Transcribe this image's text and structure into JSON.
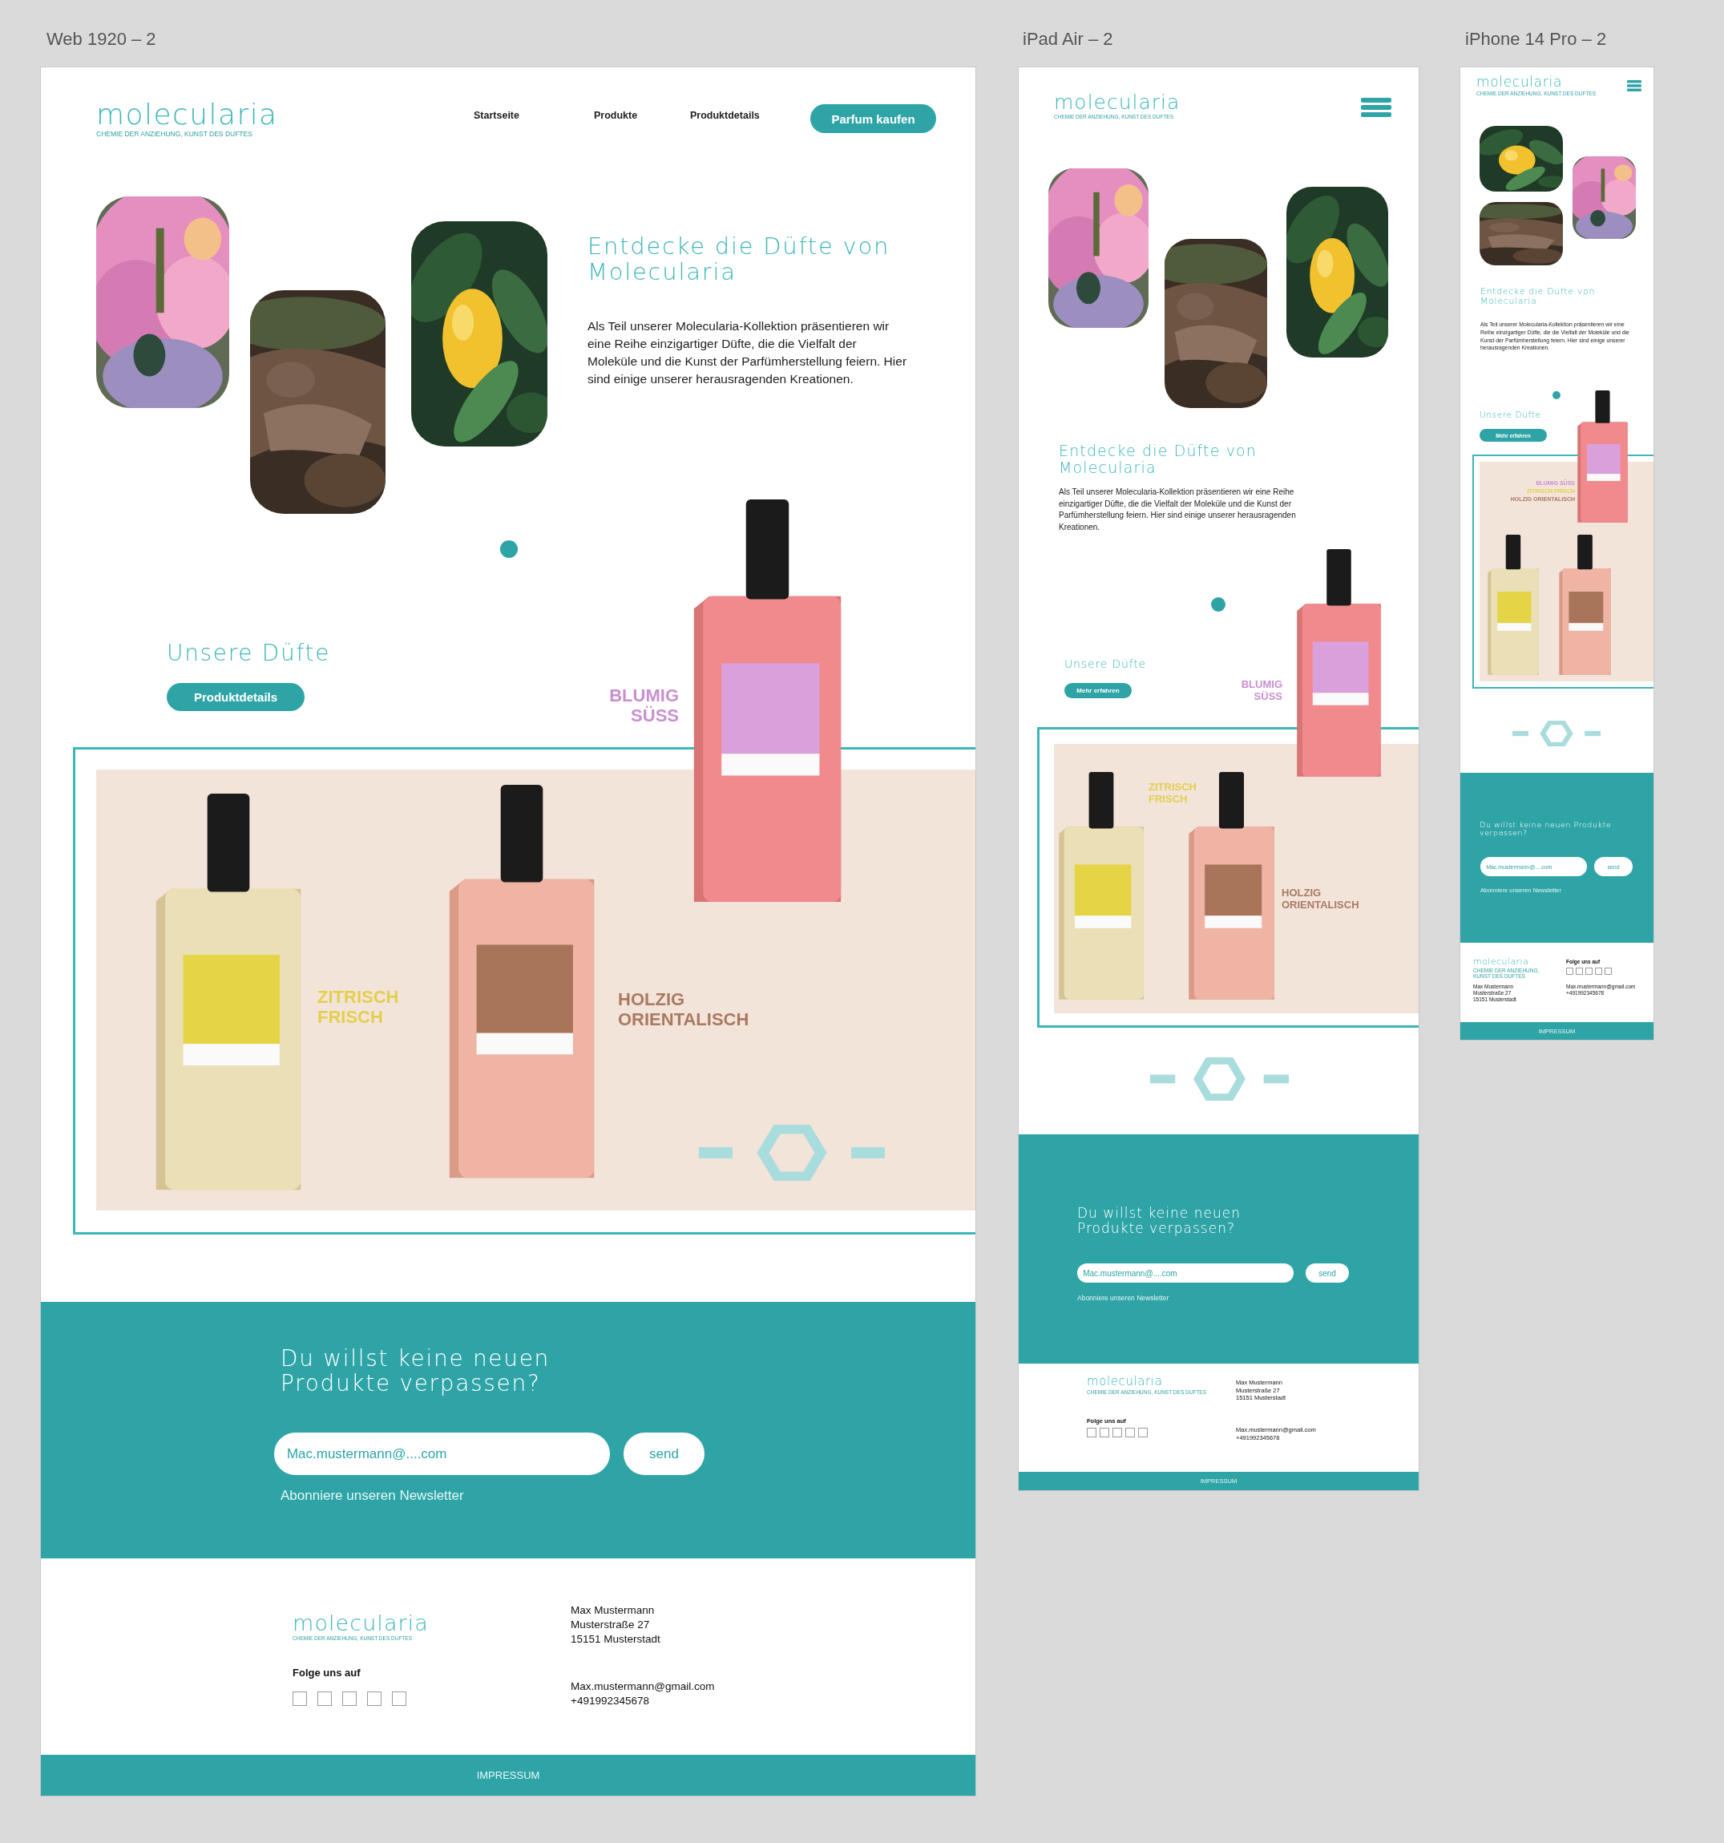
{
  "artboards": [
    {
      "kind": "web",
      "title": "Web 1920 – 2",
      "logo": {
        "name": "molecularia",
        "tagline": "CHEMIE DER ANZIEHUNG, KUNST DES DUFTES"
      },
      "nav": [
        "Startseite",
        "Produkte",
        "Produktdetails"
      ],
      "cta": "Parfum kaufen",
      "hero": {
        "heading": "Entdecke die Düfte von Molecularia",
        "text": "Als Teil unserer Molecularia-Kollektion präsentieren wir eine Reihe einzigartiger Düfte, die die Vielfalt der Moleküle und die Kunst der Parfümherstellung feiern. Hier sind einige unserer herausragenden Kreationen."
      },
      "section": {
        "heading": "Unsere Düfte",
        "button": "Produktdetails"
      },
      "scents": [
        {
          "label": "BLUMIG SÜSS",
          "color": "#c98fd0"
        },
        {
          "label": "ZITRISCH FRISCH",
          "color": "#e3cf4f"
        },
        {
          "label": "HOLZIG ORIENTALISCH",
          "color": "#a97a62"
        }
      ],
      "newsletter": {
        "heading": "Du willst keine neuen Produkte verpassen?",
        "placeholder": "Mac.mustermann@....com",
        "button": "send",
        "note": "Abonniere unseren Newsletter"
      },
      "footer": {
        "logo": {
          "name": "molecularia",
          "tagline": "CHEMIE DER ANZIEHUNG, KUNST DES DUFTES"
        },
        "follow": "Folge uns auf",
        "address": [
          "Max Mustermann",
          "Musterstraße 27",
          "15151 Musterstadt"
        ],
        "contact": [
          "Max.mustermann@gmail.com",
          "+491992345678"
        ]
      },
      "impressum": "IMPRESSUM"
    },
    {
      "kind": "tablet",
      "title": "iPad Air – 2",
      "logo": {
        "name": "molecularia",
        "tagline": "CHEMIE DER ANZIEHUNG, KUNST DES DUFTES"
      },
      "hero": {
        "heading": "Entdecke die Düfte von Molecularia",
        "text": "Als Teil unserer Molecularia-Kollektion präsentieren wir eine Reihe einzigartiger Düfte, die die Vielfalt der Moleküle und die Kunst der Parfümherstellung feiern. Hier sind einige unserer herausragenden Kreationen."
      },
      "section": {
        "heading": "Unsere Düfte",
        "button": "Mehr erfahren"
      },
      "scents": [
        {
          "label": "BLUMIG SÜSS",
          "color": "#c98fd0"
        },
        {
          "label": "ZITRISCH FRISCH",
          "color": "#e3cf4f"
        },
        {
          "label": "HOLZIG ORIENTALISCH",
          "color": "#a97a62"
        }
      ],
      "newsletter": {
        "heading": "Du willst keine neuen Produkte verpassen?",
        "placeholder": "Mac.mustermann@....com",
        "button": "send",
        "note": "Abonniere unseren Newsletter"
      },
      "footer": {
        "logo": {
          "name": "molecularia",
          "tagline": "CHEMIE DER ANZIEHUNG, KUNST DES DUFTES"
        },
        "follow": "Folge uns auf",
        "address": [
          "Max Mustermann",
          "Musterstraße 27",
          "15151 Musterstadt"
        ],
        "contact": [
          "Max.mustermann@gmail.com",
          "+491992345678"
        ]
      },
      "impressum": "IMPRESSUM"
    },
    {
      "kind": "phone",
      "title": "iPhone 14 Pro – 2",
      "logo": {
        "name": "molecularia",
        "tagline": "CHEMIE DER ANZIEHUNG, KUNST DES DUFTES"
      },
      "hero": {
        "heading": "Entdecke die Düfte von Molecularia",
        "text": "Als Teil unserer Molecularia-Kollektion präsentieren wir eine Reihe einzigartiger Düfte, die die Vielfalt der Moleküle und die Kunst der Parfümherstellung feiern. Hier sind einige unserer herausragenden Kreationen."
      },
      "section": {
        "heading": "Unsere Düfte",
        "button": "Mehr erfahren"
      },
      "scents": [
        {
          "label": "BLUMIG SÜSS",
          "color": "#c98fd0"
        },
        {
          "label": "ZITRISCH FRISCH",
          "color": "#e3cf4f"
        },
        {
          "label": "HOLZIG ORIENTALISCH",
          "color": "#a97a62"
        }
      ],
      "newsletter": {
        "heading": "Du willst keine neuen Produkte verpassen?",
        "placeholder": "Mac.mustermann@....com",
        "button": "send",
        "note": "Abonniere unseren Newsletter"
      },
      "footer": {
        "logo": {
          "name": "molecularia",
          "tagline": "CHEMIE DER ANZIEHUNG, KUNST DES DUFTES"
        },
        "follow": "Folge uns auf",
        "address": [
          "Max Mustermann",
          "Musterstraße 27",
          "15151 Musterstadt"
        ],
        "contact": [
          "Max.mustermann@gmail.com",
          "+491992345678"
        ]
      },
      "impressum": "IMPRESSUM"
    }
  ]
}
